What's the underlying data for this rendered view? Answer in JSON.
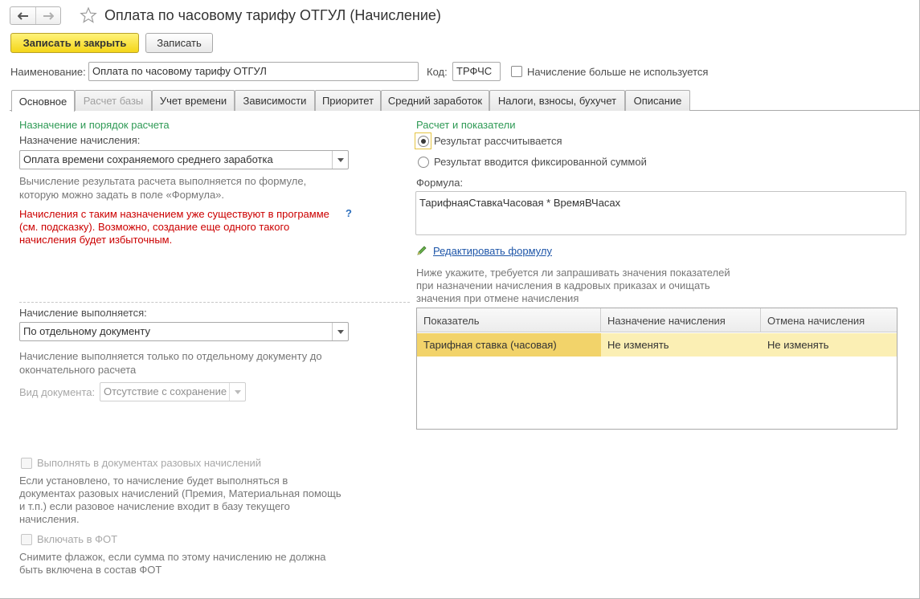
{
  "window": {
    "title": "Оплата по часовому тарифу ОТГУЛ (Начисление)"
  },
  "toolbar": {
    "save_close_label": "Записать и закрыть",
    "save_label": "Записать"
  },
  "header": {
    "name_label": "Наименование:",
    "name_value": "Оплата по часовому тарифу ОТГУЛ",
    "code_label": "Код:",
    "code_value": "ТРФЧС",
    "not_used_label": "Начисление больше не используется"
  },
  "tabs": [
    {
      "label": "Основное"
    },
    {
      "label": "Расчет базы"
    },
    {
      "label": "Учет времени"
    },
    {
      "label": "Зависимости"
    },
    {
      "label": "Приоритет"
    },
    {
      "label": "Средний заработок"
    },
    {
      "label": "Налоги, взносы, бухучет"
    },
    {
      "label": "Описание"
    }
  ],
  "left": {
    "section_title": "Назначение и порядок расчета",
    "purpose_label": "Назначение начисления:",
    "purpose_value": "Оплата времени сохраняемого среднего заработка",
    "purpose_hint_1": "Вычисление результата расчета выполняется по формуле,",
    "purpose_hint_2": "которую можно задать в поле «Формула».",
    "warning_1": "Начисления с таким назначением уже существуют в программе",
    "warning_2": "(см. подсказку). Возможно, создание еще одного такого",
    "warning_3": "начисления будет избыточным.",
    "help_mark": "?",
    "performed_label": "Начисление выполняется:",
    "performed_value": "По отдельному документу",
    "performed_hint_1": "Начисление выполняется только по отдельному документу до",
    "performed_hint_2": "окончательного расчета",
    "doc_type_label": "Вид документа:",
    "doc_type_value": "Отсутствие с сохранение",
    "onetime_label": "Выполнять в документах разовых начислений",
    "onetime_hint_1": "Если установлено, то начисление будет выполняться в",
    "onetime_hint_2": "документах разовых начислений (Премия, Материальная помощь",
    "onetime_hint_3": "и т.п.) если разовое начисление входит в базу текущего",
    "onetime_hint_4": "начисления.",
    "fot_label": "Включать в ФОТ",
    "fot_hint_1": "Снимите флажок, если сумма по этому начислению не должна",
    "fot_hint_2": "быть включена в состав ФОТ"
  },
  "right": {
    "section_title": "Расчет и показатели",
    "radio_calculated": "Результат рассчитывается",
    "radio_fixed": "Результат вводится фиксированной суммой",
    "formula_label": "Формула:",
    "formula_value": "ТарифнаяСтавкаЧасовая * ВремяВЧасах",
    "edit_formula_link": "Редактировать формулу",
    "indicators_hint_1": "Ниже укажите, требуется ли запрашивать значения показателей",
    "indicators_hint_2": "при назначении начисления в кадровых приказах и очищать",
    "indicators_hint_3": "значения при отмене начисления",
    "table": {
      "columns": [
        "Показатель",
        "Назначение начисления",
        "Отмена начисления"
      ],
      "rows": [
        [
          "Тарифная ставка (часовая)",
          "Не изменять",
          "Не изменять"
        ]
      ]
    }
  },
  "colors": {
    "accent_green": "#2e9a55",
    "warning_red": "#cc0000",
    "link_blue": "#1d55a8",
    "primary_button": "#f4d519",
    "row_highlight": "#fbefb4"
  }
}
